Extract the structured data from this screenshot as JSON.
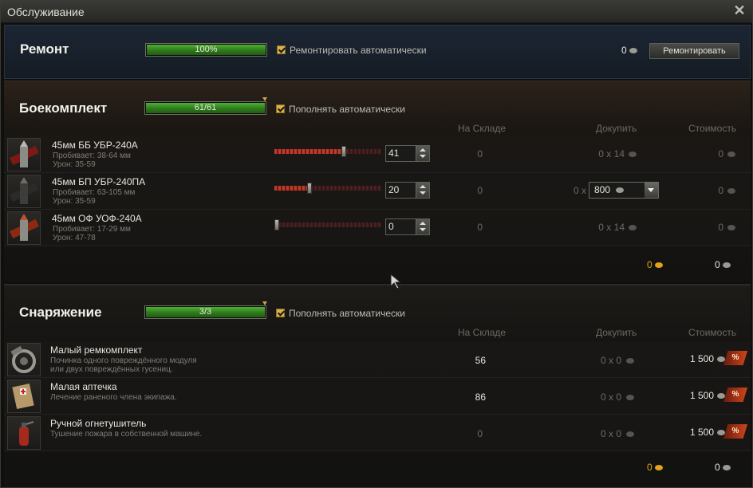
{
  "window": {
    "title": "Обслуживание",
    "close_icon": "close-icon"
  },
  "repair": {
    "title": "Ремонт",
    "progress_label": "100%",
    "progress": 1.0,
    "auto_label": "Ремонтировать автоматически",
    "auto_checked": true,
    "cost": "0",
    "button_label": "Ремонтировать"
  },
  "ammo": {
    "title": "Боекомплект",
    "progress_label": "61/61",
    "progress": 1.0,
    "auto_label": "Пополнять автоматически",
    "auto_checked": true,
    "headers": {
      "stock": "На Складе",
      "buy": "Докупить",
      "cost": "Стоимость"
    },
    "rows": [
      {
        "name": "45мм ББ УБР-240А",
        "line1": "Пробивает: 38-64 мм",
        "line2": "Урон: 35-59",
        "slider": 0.65,
        "count": "41",
        "stock": "0",
        "buy": "0 x 14",
        "cost": "0"
      },
      {
        "name": "45мм БП УБР-240ПА",
        "line1": "Пробивает: 63-105 мм",
        "line2": "Урон: 35-59",
        "slider": 0.33,
        "count": "20",
        "stock": "0",
        "buy_prefix": "0 x",
        "buy_select": "800",
        "cost": "0"
      },
      {
        "name": "45мм ОФ УОФ-240А",
        "line1": "Пробивает: 17-29 мм",
        "line2": "Урон: 47-78",
        "slider": 0.0,
        "count": "0",
        "stock": "0",
        "buy": "0 x 14",
        "cost": "0"
      }
    ],
    "total_gold": "0",
    "total_silver": "0"
  },
  "equipment": {
    "title": "Снаряжение",
    "progress_label": "3/3",
    "progress": 1.0,
    "auto_label": "Пополнять автоматически",
    "auto_checked": true,
    "headers": {
      "stock": "На Складе",
      "buy": "Докупить",
      "cost": "Стоимость"
    },
    "rows": [
      {
        "name": "Малый ремкомплект",
        "line1": "Починка одного повреждённого модуля",
        "line2": "или двух повреждённых гусениц.",
        "stock": "56",
        "buy": "0 x 0",
        "cost": "1 500",
        "discount": "%"
      },
      {
        "name": "Малая аптечка",
        "line1": "Лечение раненого члена экипажа.",
        "line2": "",
        "stock": "86",
        "buy": "0 x 0",
        "cost": "1 500",
        "discount": "%"
      },
      {
        "name": "Ручной огнетушитель",
        "line1": "Тушение пожара в собственной машине.",
        "line2": "",
        "stock": "0",
        "buy": "0 x 0",
        "cost": "1 500",
        "discount": "%"
      }
    ],
    "total_gold": "0",
    "total_silver": "0"
  }
}
